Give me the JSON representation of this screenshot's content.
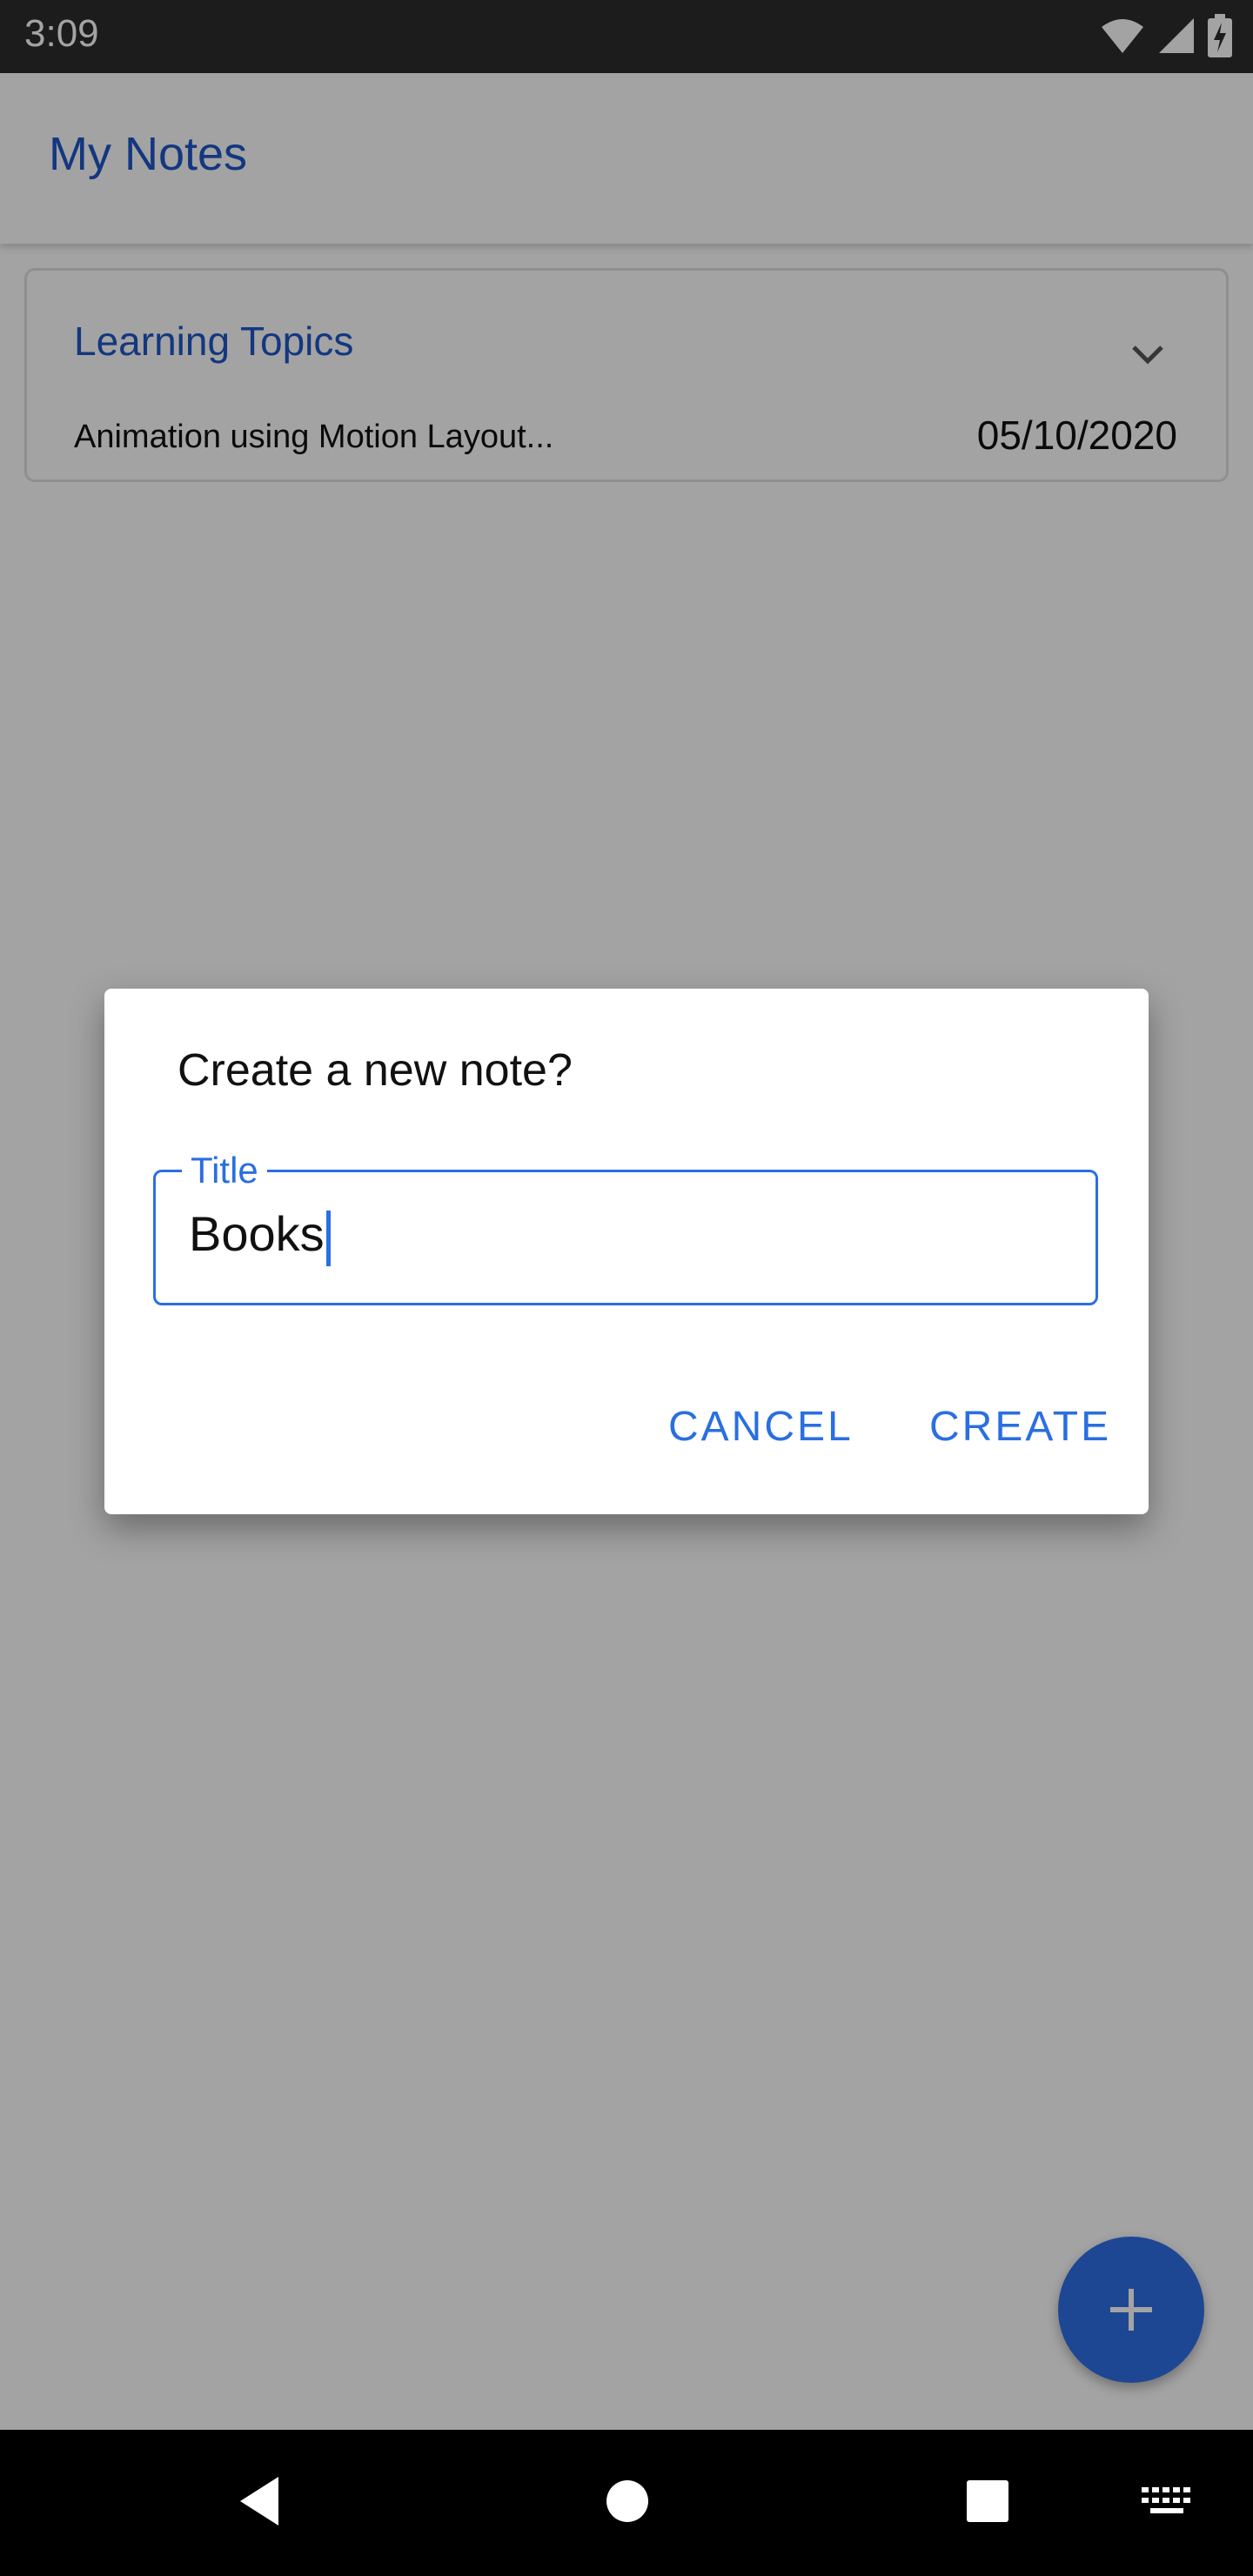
{
  "status_bar": {
    "time": "3:09"
  },
  "app_bar": {
    "title": "My Notes"
  },
  "note_card": {
    "title": "Learning Topics",
    "preview": "Animation using Motion Layout...",
    "date": "05/10/2020"
  },
  "dialog": {
    "title": "Create a new note?",
    "field_label": "Title",
    "field_value": "Books",
    "cancel_label": "CANCEL",
    "create_label": "CREATE"
  },
  "icons": {
    "expand": "chevron-down-icon",
    "fab": "plus-icon",
    "nav_back": "back-icon",
    "nav_home": "home-icon",
    "nav_recents": "recents-icon",
    "nav_keyboard": "keyboard-icon"
  },
  "colors": {
    "accent": "#2a6fe0",
    "brand_text": "#1f56c9",
    "fab": "#2f6fe7"
  }
}
